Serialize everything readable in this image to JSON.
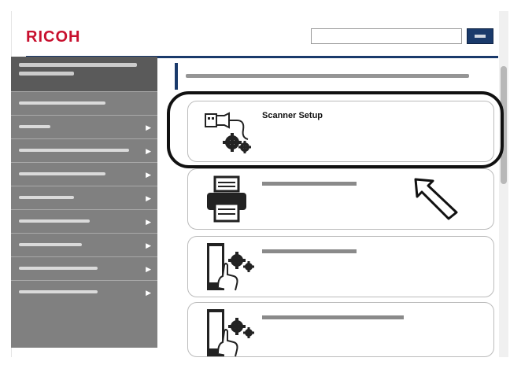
{
  "header": {
    "logo": "RICOH"
  },
  "cards": [
    {
      "title": "Scanner Setup",
      "icon": "usb-gear-icon"
    },
    {
      "title": "",
      "icon": "scanner-icon"
    },
    {
      "title": "",
      "icon": "touch-panel-icon"
    },
    {
      "title": "",
      "icon": "touch-panel-icon"
    }
  ],
  "colors": {
    "brand": "#c8102e",
    "navy": "#1a3a6b",
    "sidebar": "#808080"
  }
}
